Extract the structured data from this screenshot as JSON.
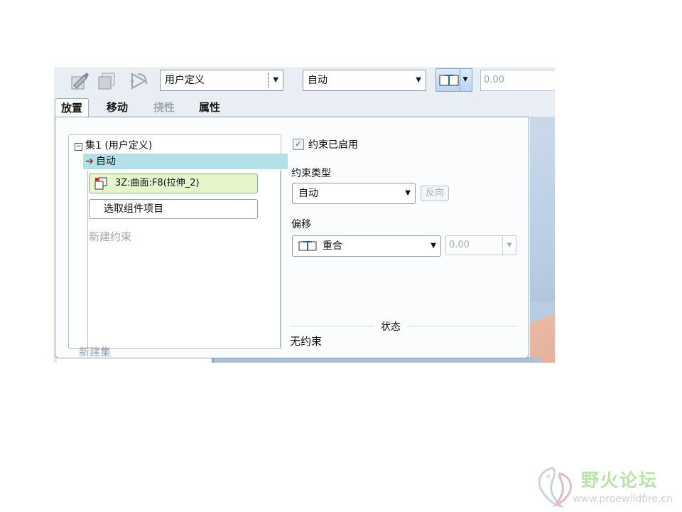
{
  "toolbar": {
    "set_type_select": "用户定义",
    "constraint_type_select": "自动",
    "offset_value": "0.00",
    "icons": [
      "sketch-edit-icon",
      "copy-layer-icon",
      "bend-arrow-icon",
      "coincident-icon"
    ]
  },
  "tabs": [
    {
      "label": "放置",
      "state": "active"
    },
    {
      "label": "移动",
      "state": "normal"
    },
    {
      "label": "挠性",
      "state": "disabled"
    },
    {
      "label": "属性",
      "state": "normal"
    }
  ],
  "set_panel": {
    "set_title": "集1 (用户定义)",
    "selected_constraint": "自动",
    "references": [
      {
        "label": "3Z:曲面:F8(拉伸_2)",
        "icon": "surface-icon"
      },
      {
        "label": "选取组件项目"
      }
    ],
    "new_constraint": "新建约束",
    "new_set": "新建集"
  },
  "constraint_panel": {
    "enabled_label": "约束已启用",
    "enabled": true,
    "type_label": "约束类型",
    "type_value": "自动",
    "flip_label": "反向",
    "offset_label": "偏移",
    "offset_type": "重合",
    "offset_value": "0.00",
    "status_title": "状态",
    "status_text": "无约束"
  },
  "watermark": {
    "title": "野火论坛",
    "url": "www.proewildfire.cn"
  }
}
